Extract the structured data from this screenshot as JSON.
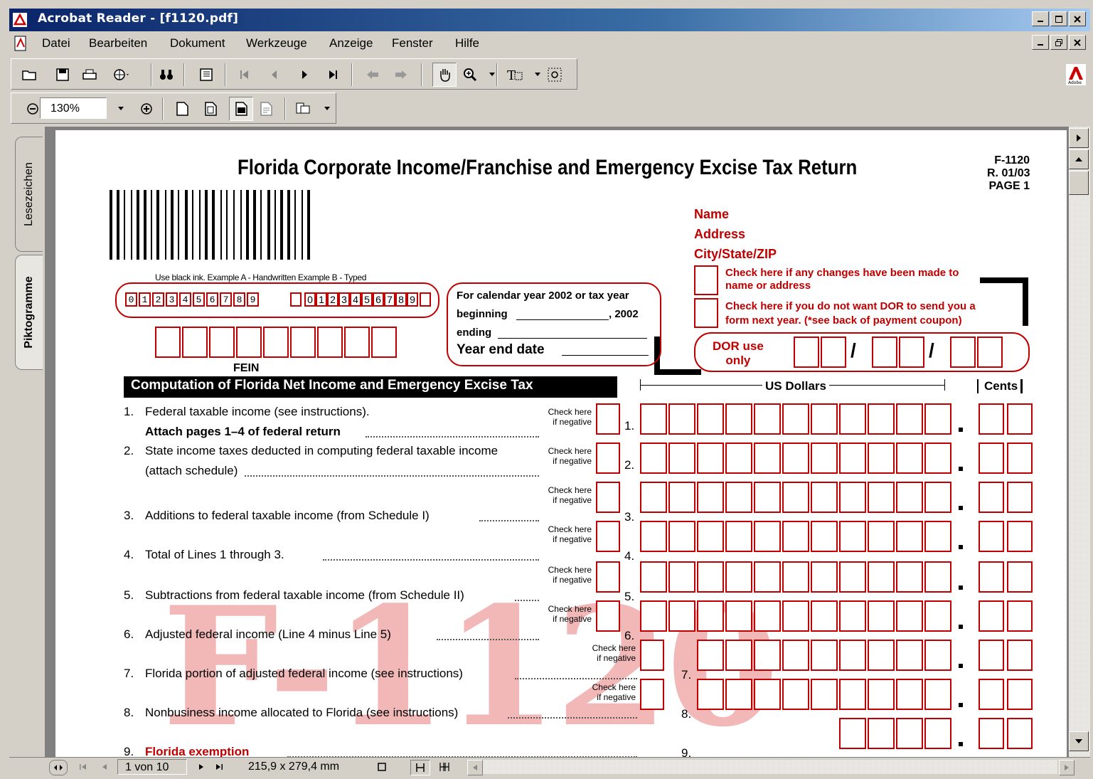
{
  "window": {
    "title": "Acrobat Reader - [f1120.pdf]"
  },
  "menu": [
    "Datei",
    "Bearbeiten",
    "Dokument",
    "Werkzeuge",
    "Anzeige",
    "Fenster",
    "Hilfe"
  ],
  "toolbar": {
    "zoom_value": "130%"
  },
  "side_tabs": [
    "Lesezeichen",
    "Piktogramme"
  ],
  "status": {
    "page": "1 von 10",
    "size": "215,9 x 279,4 mm"
  },
  "form": {
    "title": "Florida Corporate Income/Franchise and Emergency Excise Tax Return",
    "form_id": "F-1120",
    "revision": "R. 01/03",
    "page_label": "PAGE 1",
    "name_label": "Name",
    "address_label": "Address",
    "city_label": "City/State/ZIP",
    "check_changes": "Check here if any changes have been made to name or address",
    "check_changes_1": "Check here if any changes have been made to",
    "check_changes_2": "name or address",
    "check_notsend_1": "Check here if you do not want DOR to send you a",
    "check_notsend_2": "form next year. (*see back of payment coupon)",
    "ink_note": "Use black ink.  Example A - Handwritten  Example B - Typed",
    "example_a": "0123456789",
    "example_b": "0123456789",
    "calendar_line1": "For calendar year 2002 or tax year",
    "calendar_beginning": "beginning",
    "calendar_year": ", 2002",
    "calendar_ending": "ending",
    "year_end": "Year end date",
    "fein_label": "FEIN",
    "dor_label_1": "DOR use",
    "dor_label_2": "only",
    "section_title": "Computation of Florida Net Income and Emergency Excise Tax",
    "us_dollars": "US Dollars",
    "cents": "Cents",
    "check_here": "Check here",
    "if_negative": "if negative",
    "watermark": "F-1120",
    "lines": [
      {
        "num": "1.",
        "text": "Federal taxable income (see instructions).",
        "text2": "Attach pages 1–4 of federal return",
        "ref": "1."
      },
      {
        "num": "2.",
        "text": "State income taxes deducted in computing federal taxable income",
        "text2": "(attach schedule)",
        "ref": "2."
      },
      {
        "num": "3.",
        "text": "Additions to federal taxable income (from Schedule I)",
        "ref": "3."
      },
      {
        "num": "4.",
        "text": "Total of Lines 1 through 3.",
        "ref": "4."
      },
      {
        "num": "5.",
        "text": "Subtractions from federal taxable income (from Schedule II)",
        "ref": "5."
      },
      {
        "num": "6.",
        "text": "Adjusted federal income (Line 4 minus Line 5)",
        "ref": "6."
      },
      {
        "num": "7.",
        "text": "Florida portion of adjusted federal income (see instructions)",
        "ref": "7."
      },
      {
        "num": "8.",
        "text": "Nonbusiness income allocated to Florida (see instructions)",
        "ref": "8."
      },
      {
        "num": "9.",
        "text": "Florida exemption",
        "ref": "9."
      }
    ]
  }
}
